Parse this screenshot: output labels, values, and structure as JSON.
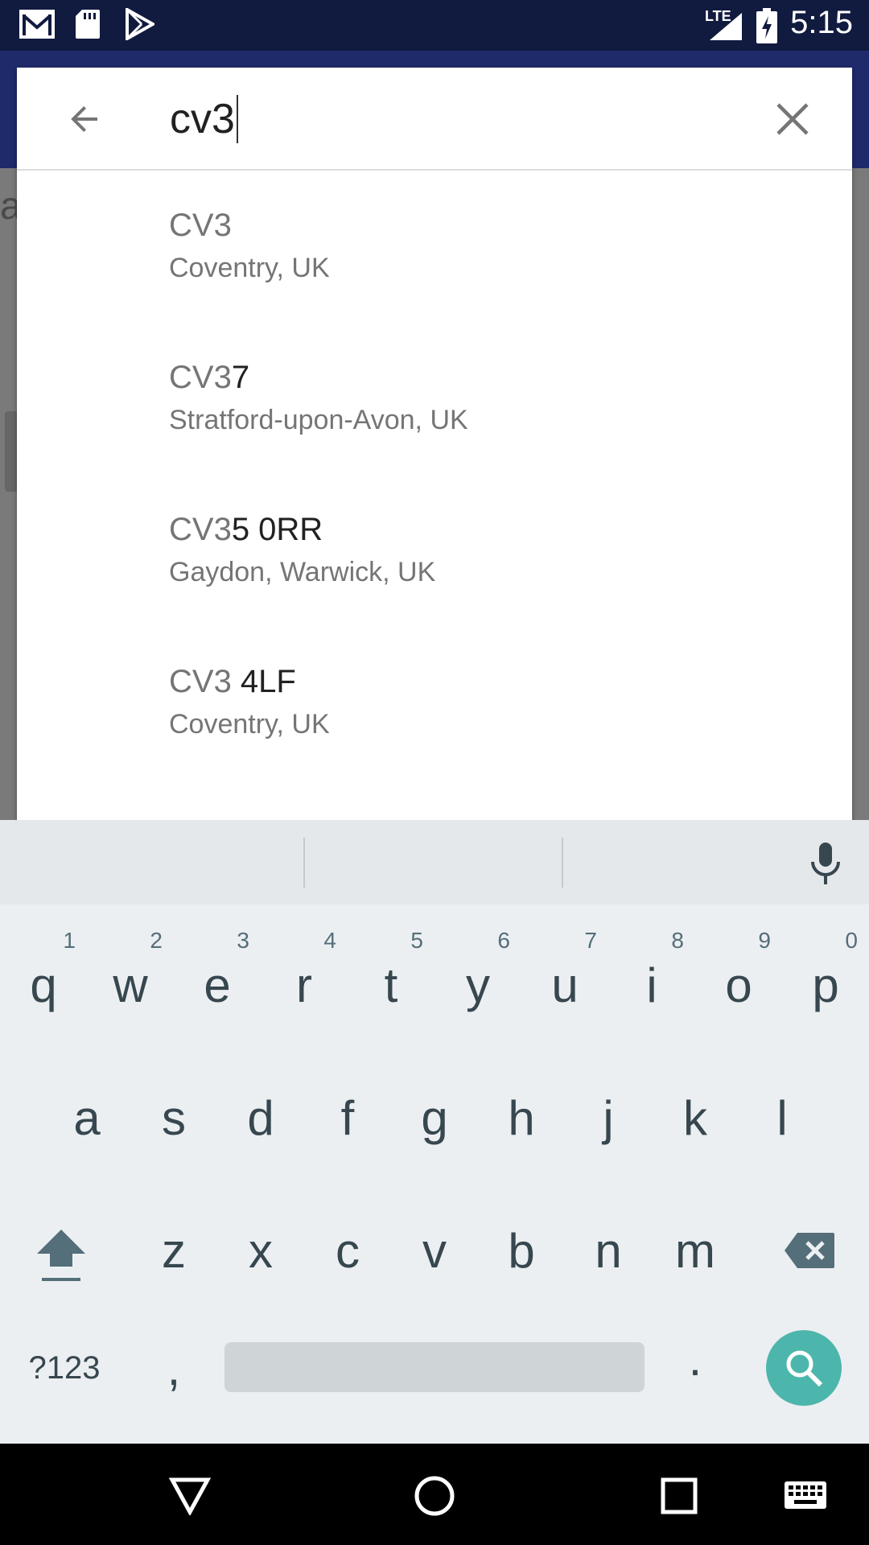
{
  "status_bar": {
    "time": "5:15",
    "network": "LTE",
    "icons": [
      "gmail-icon",
      "sd-card-icon",
      "play-store-icon",
      "signal-icon",
      "battery-icon"
    ]
  },
  "background": {
    "peek_text": "a"
  },
  "search": {
    "value": "cv3",
    "back_icon": "arrow-left-icon",
    "clear_icon": "close-icon"
  },
  "suggestions": [
    {
      "match": "CV3",
      "rest": "",
      "sub": "Coventry, UK"
    },
    {
      "match": "CV3",
      "rest": "7",
      "sub": "Stratford-upon-Avon, UK"
    },
    {
      "match": "CV3",
      "rest": "5 0RR",
      "sub": "Gaydon, Warwick, UK"
    },
    {
      "match": "CV3",
      "rest": " 4LF",
      "sub": "Coventry, UK"
    }
  ],
  "keyboard": {
    "row1": [
      {
        "k": "q",
        "h": "1"
      },
      {
        "k": "w",
        "h": "2"
      },
      {
        "k": "e",
        "h": "3"
      },
      {
        "k": "r",
        "h": "4"
      },
      {
        "k": "t",
        "h": "5"
      },
      {
        "k": "y",
        "h": "6"
      },
      {
        "k": "u",
        "h": "7"
      },
      {
        "k": "i",
        "h": "8"
      },
      {
        "k": "o",
        "h": "9"
      },
      {
        "k": "p",
        "h": "0"
      }
    ],
    "row2": [
      "a",
      "s",
      "d",
      "f",
      "g",
      "h",
      "j",
      "k",
      "l"
    ],
    "row3": [
      "z",
      "x",
      "c",
      "v",
      "b",
      "n",
      "m"
    ],
    "symbols_label": "?123",
    "comma": ",",
    "period": ".",
    "accent_color": "#4db6ac"
  },
  "colors": {
    "status_bar": "#111a3f",
    "app_bar": "#1f2a6b",
    "keyboard_bg": "#eceff1"
  }
}
